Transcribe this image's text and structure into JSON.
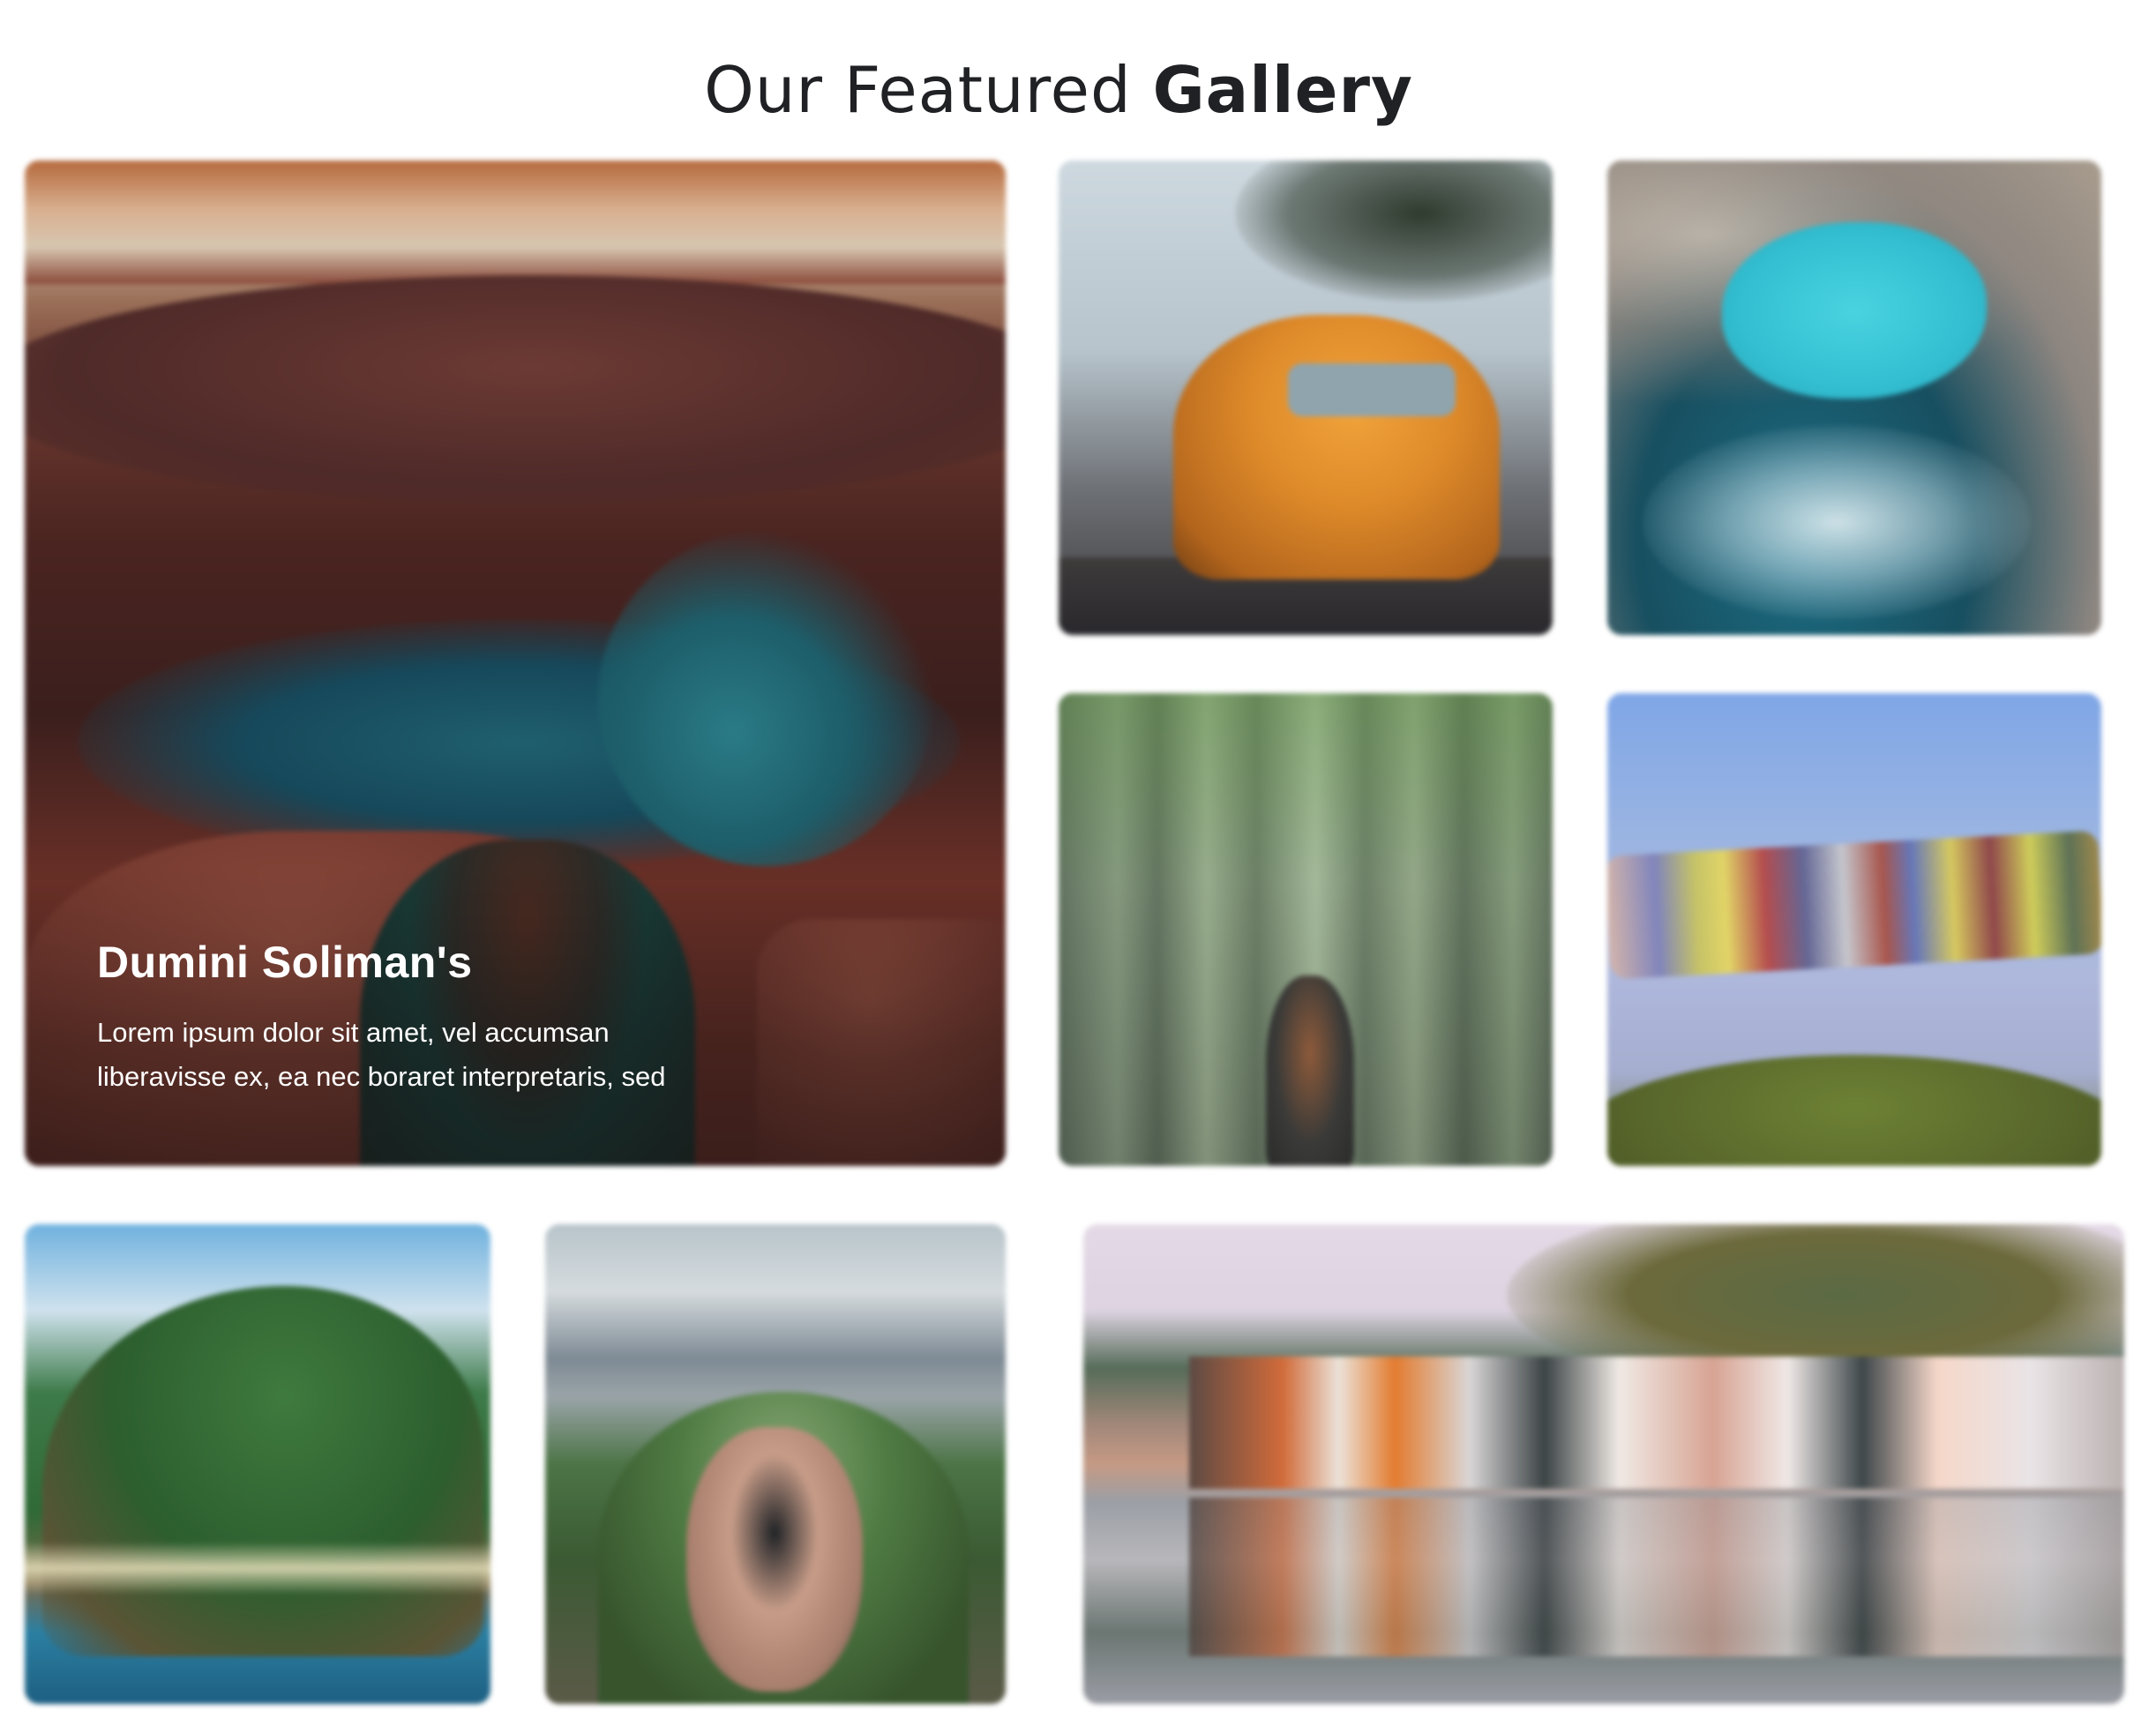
{
  "heading": {
    "prefix": "Our Featured",
    "emphasis": "Gallery"
  },
  "featured": {
    "title": "Dumini Soliman's",
    "description_line1": "Lorem ipsum dolor sit amet, vel accumsan",
    "description_line2": "liberavisse ex, ea nec boraret interpretaris, sed"
  },
  "gallery_images": [
    "red canyon with river and person",
    "orange van by the beach",
    "aerial rock pool and ocean",
    "person in bamboo forest",
    "prayer flags over mountains",
    "green mountain coastline",
    "hand holding compass on ridge",
    "colorful houses reflected in water"
  ]
}
